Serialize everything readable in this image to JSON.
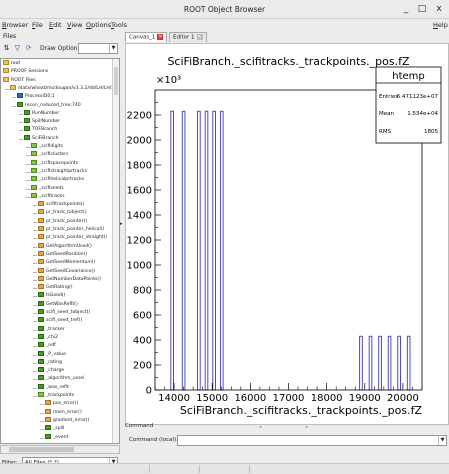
{
  "window": {
    "title": "ROOT Object Browser",
    "minimize": "_",
    "maximize": "□",
    "close": "x"
  },
  "menu": {
    "items": [
      {
        "label": "Browser",
        "u": "B",
        "rest": "rowser"
      },
      {
        "label": "File",
        "u": "F",
        "rest": "ile"
      },
      {
        "label": "Edit",
        "u": "E",
        "rest": "dit"
      },
      {
        "label": "View",
        "u": "V",
        "rest": "iew"
      },
      {
        "label": "Options",
        "u": "O",
        "rest": "ptions"
      },
      {
        "label": "Tools",
        "u": "T",
        "rest": "ools"
      }
    ],
    "help": {
      "label": "Help",
      "u": "H",
      "rest": "elp"
    }
  },
  "left": {
    "files_label": "Files",
    "draw_option_label": "Draw Option:",
    "draw_option_value": "",
    "filter_label": "Filter:",
    "filter_value": "All Files (*.*)"
  },
  "tree": [
    {
      "label": "root",
      "icon": "folder",
      "level": 0
    },
    {
      "label": "PROOF Sessions",
      "icon": "folder",
      "level": 0
    },
    {
      "label": "ROOT Files",
      "icon": "folder",
      "level": 0
    },
    {
      "label": "/data/wheat/mcdougan/v3.3.2/dd/LH/LH/...",
      "icon": "folder",
      "level": 1
    },
    {
      "label": "ProcessID0;1",
      "icon": "leaff",
      "level": 2
    },
    {
      "label": "recon_reduced_tree;740",
      "icon": "leafg",
      "level": 2
    },
    {
      "label": "RunNumber",
      "icon": "leafg",
      "level": 3
    },
    {
      "label": "SpillNumber",
      "icon": "leafg",
      "level": 3
    },
    {
      "label": "TOFBranch",
      "icon": "leafg",
      "level": 3
    },
    {
      "label": "SciFiBranch",
      "icon": "leafg",
      "level": 3
    },
    {
      "label": "_scifidigits",
      "icon": "branch",
      "level": 4
    },
    {
      "label": "_scificlusters",
      "icon": "branch",
      "level": 4
    },
    {
      "label": "_scifispacepoints",
      "icon": "branch",
      "level": 4
    },
    {
      "label": "_scifistraightprtracks",
      "icon": "branch",
      "level": 4
    },
    {
      "label": "_scifihelicalprtracks",
      "icon": "branch",
      "level": 4
    },
    {
      "label": "_scifiseeds",
      "icon": "branch",
      "level": 4
    },
    {
      "label": "_scifitracks",
      "icon": "branch",
      "level": 4
    },
    {
      "label": "scifitrackpoints()",
      "icon": "meth",
      "level": 5
    },
    {
      "label": "pr_track_tobject()",
      "icon": "meth",
      "level": 5
    },
    {
      "label": "pr_track_pointer()",
      "icon": "meth",
      "level": 5
    },
    {
      "label": "pr_track_pointer_helical()",
      "icon": "meth",
      "level": 5
    },
    {
      "label": "pr_track_pointer_straight()",
      "icon": "meth",
      "level": 5
    },
    {
      "label": "GetAlgorithmUsed()",
      "icon": "meth",
      "level": 5
    },
    {
      "label": "GetSeedPosition()",
      "icon": "meth",
      "level": 5
    },
    {
      "label": "GetSeedMomentum()",
      "icon": "meth",
      "level": 5
    },
    {
      "label": "GetSeedCovariance()",
      "icon": "meth",
      "level": 5
    },
    {
      "label": "GetNumberDataPoints()",
      "icon": "meth",
      "level": 5
    },
    {
      "label": "GetRating()",
      "icon": "meth",
      "level": 5
    },
    {
      "label": "IsGood()",
      "icon": "leafg",
      "level": 5
    },
    {
      "label": "GetWasRefit()",
      "icon": "leafg",
      "level": 5
    },
    {
      "label": "scifi_seed_tobject()",
      "icon": "leafg",
      "level": 5
    },
    {
      "label": "scifi_seed_tref()",
      "icon": "leafg",
      "level": 5
    },
    {
      "label": "_tracker",
      "icon": "leafg",
      "level": 5
    },
    {
      "label": "_chi2",
      "icon": "leafg",
      "level": 5
    },
    {
      "label": "_ndf",
      "icon": "leafg",
      "level": 5
    },
    {
      "label": "_P_value",
      "icon": "leafg",
      "level": 5
    },
    {
      "label": "_rating",
      "icon": "leafg",
      "level": 5
    },
    {
      "label": "_charge",
      "icon": "leafg",
      "level": 5
    },
    {
      "label": "_algorithm_used",
      "icon": "leafg",
      "level": 5
    },
    {
      "label": "_was_refit",
      "icon": "leafg",
      "level": 5
    },
    {
      "label": "_trackpoints",
      "icon": "branch",
      "level": 5
    },
    {
      "label": "pos_error()",
      "icon": "meth",
      "level": 6
    },
    {
      "label": "mom_error()",
      "icon": "meth",
      "level": 6
    },
    {
      "label": "gradient_error()",
      "icon": "meth",
      "level": 6
    },
    {
      "label": "_spill",
      "icon": "leafg",
      "level": 6
    },
    {
      "label": "_event",
      "icon": "leafg",
      "level": 6
    }
  ],
  "tabs": [
    {
      "label": "Canvas_1"
    },
    {
      "label": "Editor 1"
    }
  ],
  "stats": {
    "name": "htemp",
    "entries_label": "Entries",
    "entries": "6.471123e+07",
    "mean_label": "Mean",
    "mean": "1.534e+04",
    "rms_label": "RMS",
    "rms": "1805"
  },
  "command": {
    "tab_label": "Command",
    "label": "Command (local):",
    "value": ""
  },
  "chart_data": {
    "type": "bar",
    "title": "SciFiBranch._scifitracks._trackpoints._pos.fZ",
    "xlabel": "SciFiBranch._scifitracks._trackpoints._pos.fZ",
    "ylabel": "",
    "y_multiplier": "×10³",
    "xlim": [
      13500,
      20500
    ],
    "ylim": [
      0,
      2400
    ],
    "xticks": [
      14000,
      15000,
      16000,
      17000,
      18000,
      19000,
      20000
    ],
    "yticks": [
      0,
      200,
      400,
      600,
      800,
      1000,
      1200,
      1400,
      1600,
      1800,
      2000,
      2200
    ],
    "bin_width": 70,
    "bins": [
      {
        "x": 13950,
        "value": 2230
      },
      {
        "x": 14250,
        "value": 2230
      },
      {
        "x": 14650,
        "value": 2230
      },
      {
        "x": 14850,
        "value": 2230
      },
      {
        "x": 15050,
        "value": 2230
      },
      {
        "x": 15250,
        "value": 2230
      },
      {
        "x": 18900,
        "value": 430
      },
      {
        "x": 19150,
        "value": 430
      },
      {
        "x": 19400,
        "value": 430
      },
      {
        "x": 19650,
        "value": 430
      },
      {
        "x": 19900,
        "value": 430
      },
      {
        "x": 20150,
        "value": 430
      }
    ]
  }
}
